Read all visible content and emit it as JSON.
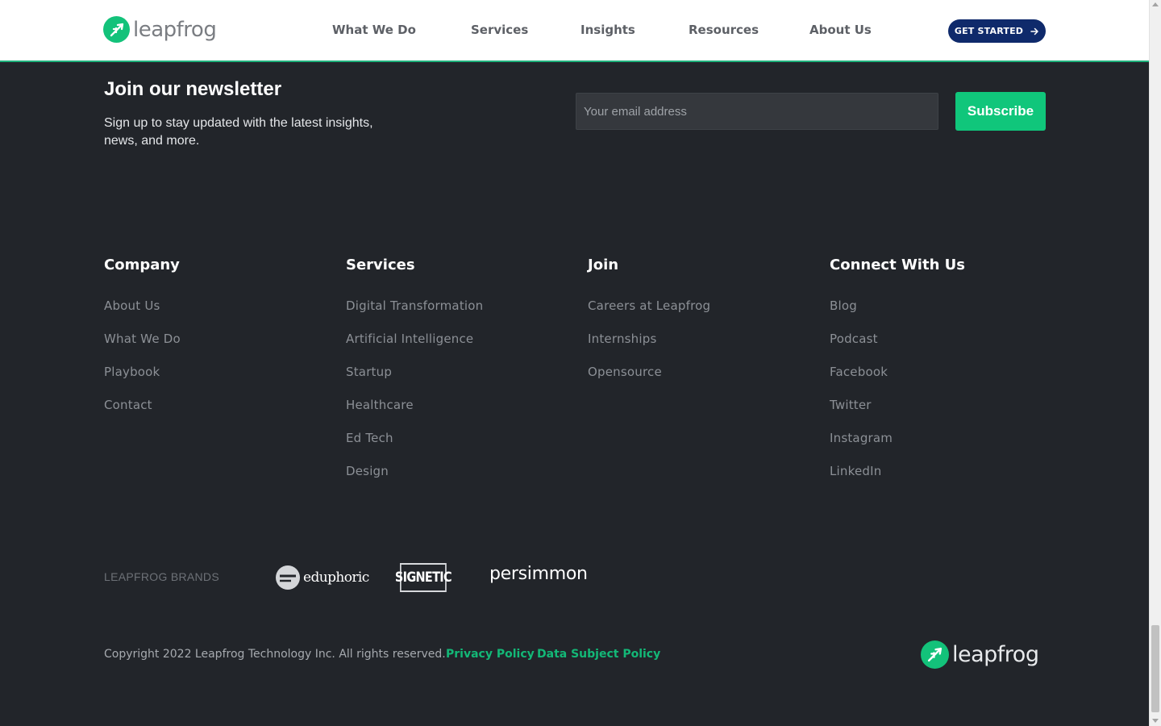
{
  "header": {
    "logo_text": "leapfrog",
    "nav": [
      "What We Do",
      "Services",
      "Insights",
      "Resources",
      "About Us"
    ],
    "cta_label": "GET STARTED"
  },
  "newsletter": {
    "title": "Join our newsletter",
    "description": "Sign up to stay updated with the latest insights, news, and more.",
    "email_placeholder": "Your email address",
    "subscribe_label": "Subscribe"
  },
  "footer": {
    "columns": [
      {
        "title": "Company",
        "links": [
          "About Us",
          "What We Do",
          "Playbook",
          "Contact"
        ]
      },
      {
        "title": "Services",
        "links": [
          "Digital Transformation",
          "Artificial Intelligence",
          "Startup",
          "Healthcare",
          "Ed Tech",
          "Design"
        ]
      },
      {
        "title": "Join",
        "links": [
          "Careers at Leapfrog",
          "Internships",
          "Opensource"
        ]
      },
      {
        "title": "Connect With Us",
        "links": [
          "Blog",
          "Podcast",
          "Facebook",
          "Twitter",
          "Instagram",
          "LinkedIn"
        ]
      }
    ],
    "brands_label": "LEAPFROG BRANDS",
    "brands": [
      "eduphoric",
      "SIGNETIC",
      "persimmon"
    ],
    "copyright": "Copyright 2022 Leapfrog Technology Inc. All rights reserved.",
    "privacy_policy": "Privacy Policy",
    "data_subject_policy": "Data Subject Policy",
    "logo_text": "leapfrog"
  },
  "colors": {
    "brand_green": "#13c27a",
    "cta_navy": "#0f2a6b",
    "footer_bg": "#22252a"
  },
  "icons": {
    "logo": "leapfrog-plane-icon",
    "cta_arrow": "arrow-right-icon",
    "edu_logo": "eduphoric-e-icon"
  }
}
